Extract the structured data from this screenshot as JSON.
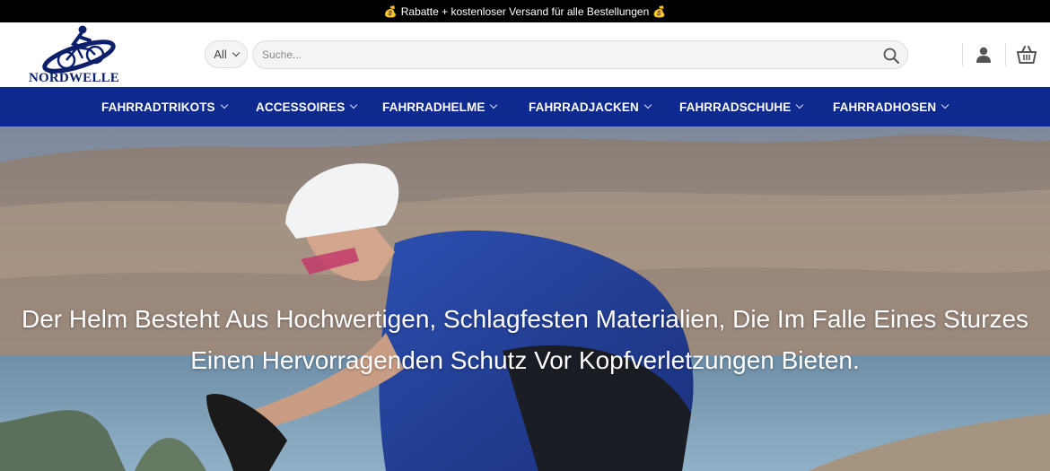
{
  "promo": {
    "text": "Rabatte + kostenloser Versand für alle Bestellungen",
    "icon": "money-bag-icon"
  },
  "header": {
    "logo_text": "NORDWELLE",
    "category_select": "All",
    "search_placeholder": "Suche...",
    "icons": [
      "search-icon",
      "user-icon",
      "cart-icon"
    ]
  },
  "nav": {
    "items": [
      {
        "label": "FAHRRADTRIKOTS"
      },
      {
        "label": "ACCESSOIRES"
      },
      {
        "label": "FAHRRADHELME"
      },
      {
        "label": "FAHRRADJACKEN"
      },
      {
        "label": "FAHRRADSCHUHE"
      },
      {
        "label": "FAHRRADHOSEN"
      }
    ]
  },
  "hero": {
    "line1": "Der Helm Besteht Aus Hochwertigen, Schlagfesten Materialien, Die Im Falle Eines Sturzes",
    "line2": "Einen Hervorragenden Schutz Vor Kopfverletzungen Bieten."
  },
  "colors": {
    "promo_bg": "#000000",
    "nav_bg": "#0e2a8e",
    "logo_blue": "#0b1f6b"
  }
}
